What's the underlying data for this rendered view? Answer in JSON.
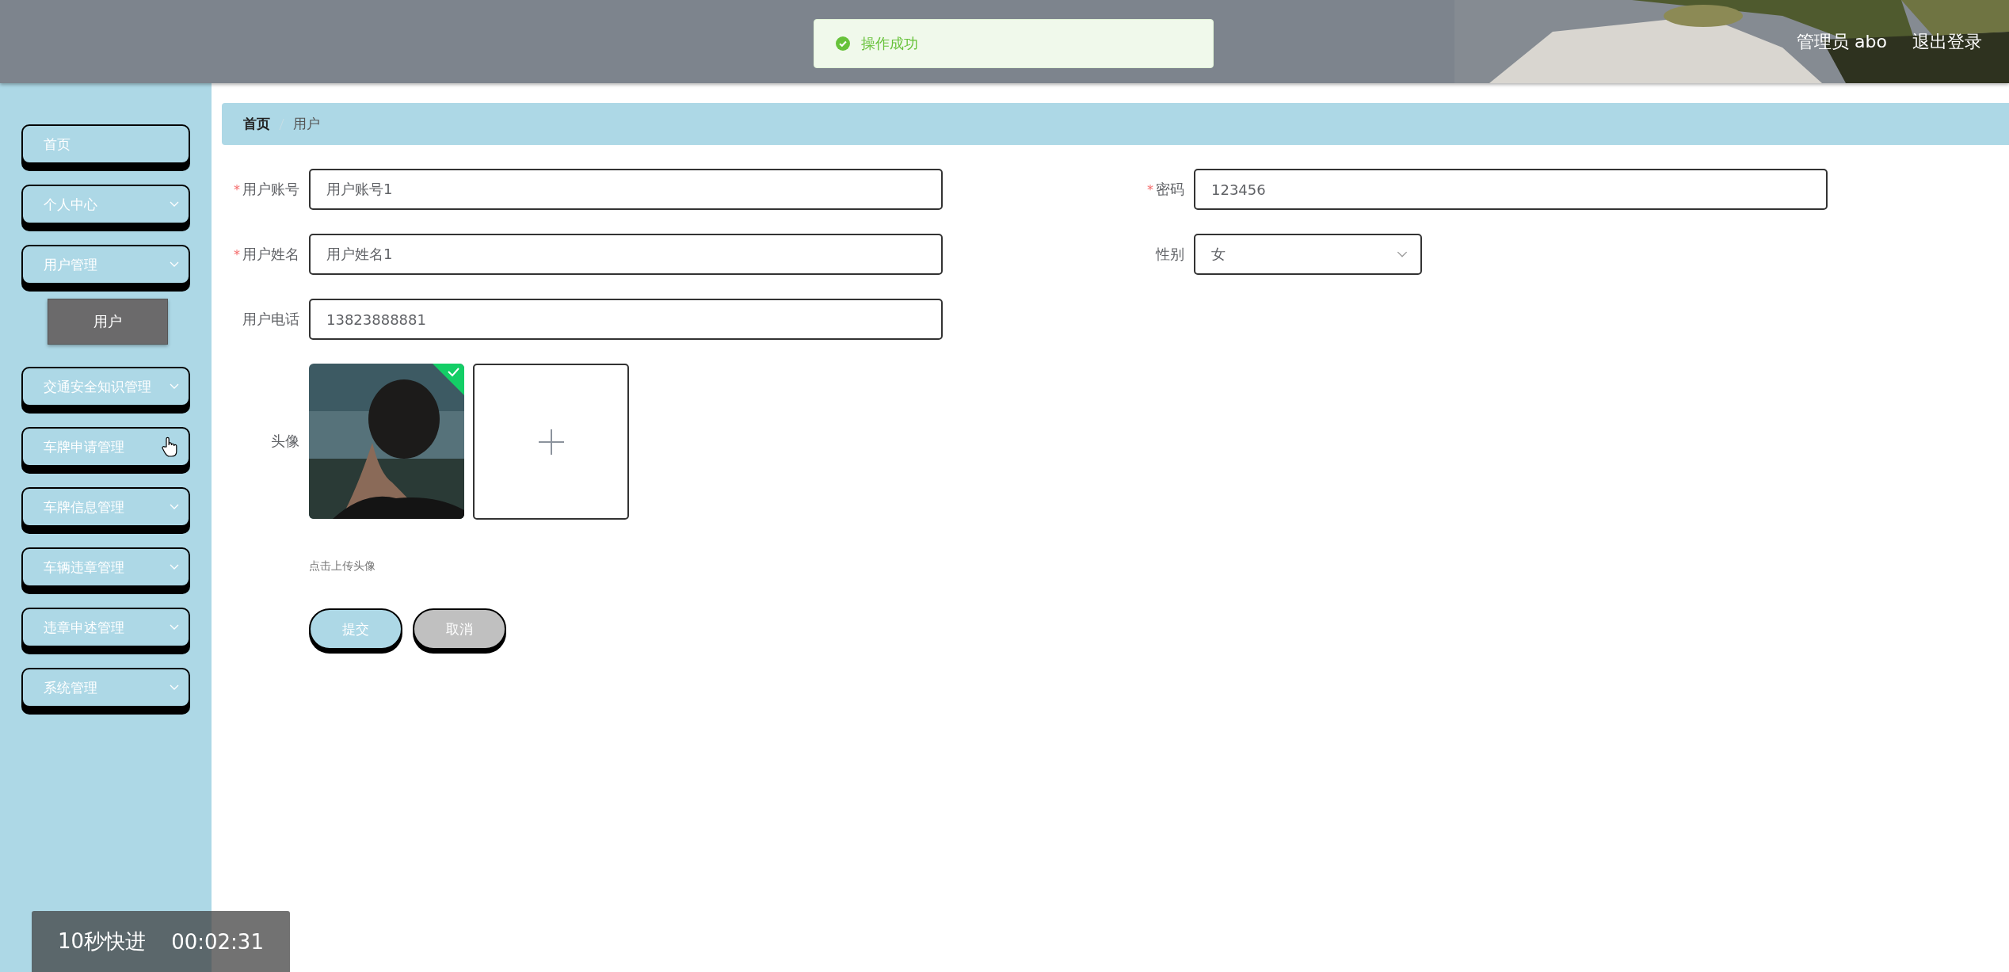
{
  "header": {
    "user_label": "管理员 abo",
    "logout": "退出登录"
  },
  "toast": {
    "message": "操作成功"
  },
  "sidebar": {
    "items": [
      {
        "label": "首页",
        "kind": "link",
        "hovered": false
      },
      {
        "label": "个人中心",
        "kind": "submenu",
        "hovered": false
      },
      {
        "label": "用户管理",
        "kind": "submenu",
        "hovered": false,
        "children": [
          {
            "label": "用户",
            "selected": true
          }
        ]
      },
      {
        "label": "交通安全知识管理",
        "kind": "submenu",
        "hovered": false
      },
      {
        "label": "车牌申请管理",
        "kind": "submenu",
        "hovered": true
      },
      {
        "label": "车牌信息管理",
        "kind": "submenu",
        "hovered": false
      },
      {
        "label": "车辆违章管理",
        "kind": "submenu",
        "hovered": false
      },
      {
        "label": "违章申述管理",
        "kind": "submenu",
        "hovered": false
      },
      {
        "label": "系统管理",
        "kind": "submenu",
        "hovered": false
      }
    ]
  },
  "breadcrumb": [
    {
      "label": "首页"
    },
    {
      "label": "用户"
    }
  ],
  "form": {
    "rows": [
      [
        {
          "label": "用户账号",
          "required_mark": "*",
          "kind": "text",
          "value": "用户账号1"
        },
        {
          "label": "密码",
          "required_mark": "*",
          "kind": "text",
          "value": "123456"
        }
      ],
      [
        {
          "label": "用户姓名",
          "required_mark": "*",
          "kind": "text",
          "value": "用户姓名1"
        },
        {
          "label": "性别",
          "kind": "select",
          "value": "女"
        }
      ],
      [
        {
          "label": "用户电话",
          "kind": "text",
          "value": "13823888881"
        }
      ]
    ],
    "avatar": {
      "label": "头像",
      "uploaded": true,
      "hint": "点击上传头像"
    },
    "buttons": [
      {
        "label": "提交",
        "kind": "primary"
      },
      {
        "label": "取消",
        "kind": "secondary"
      }
    ]
  },
  "video_overlay": {
    "skip": "10秒快进",
    "time": "00:02:31"
  }
}
